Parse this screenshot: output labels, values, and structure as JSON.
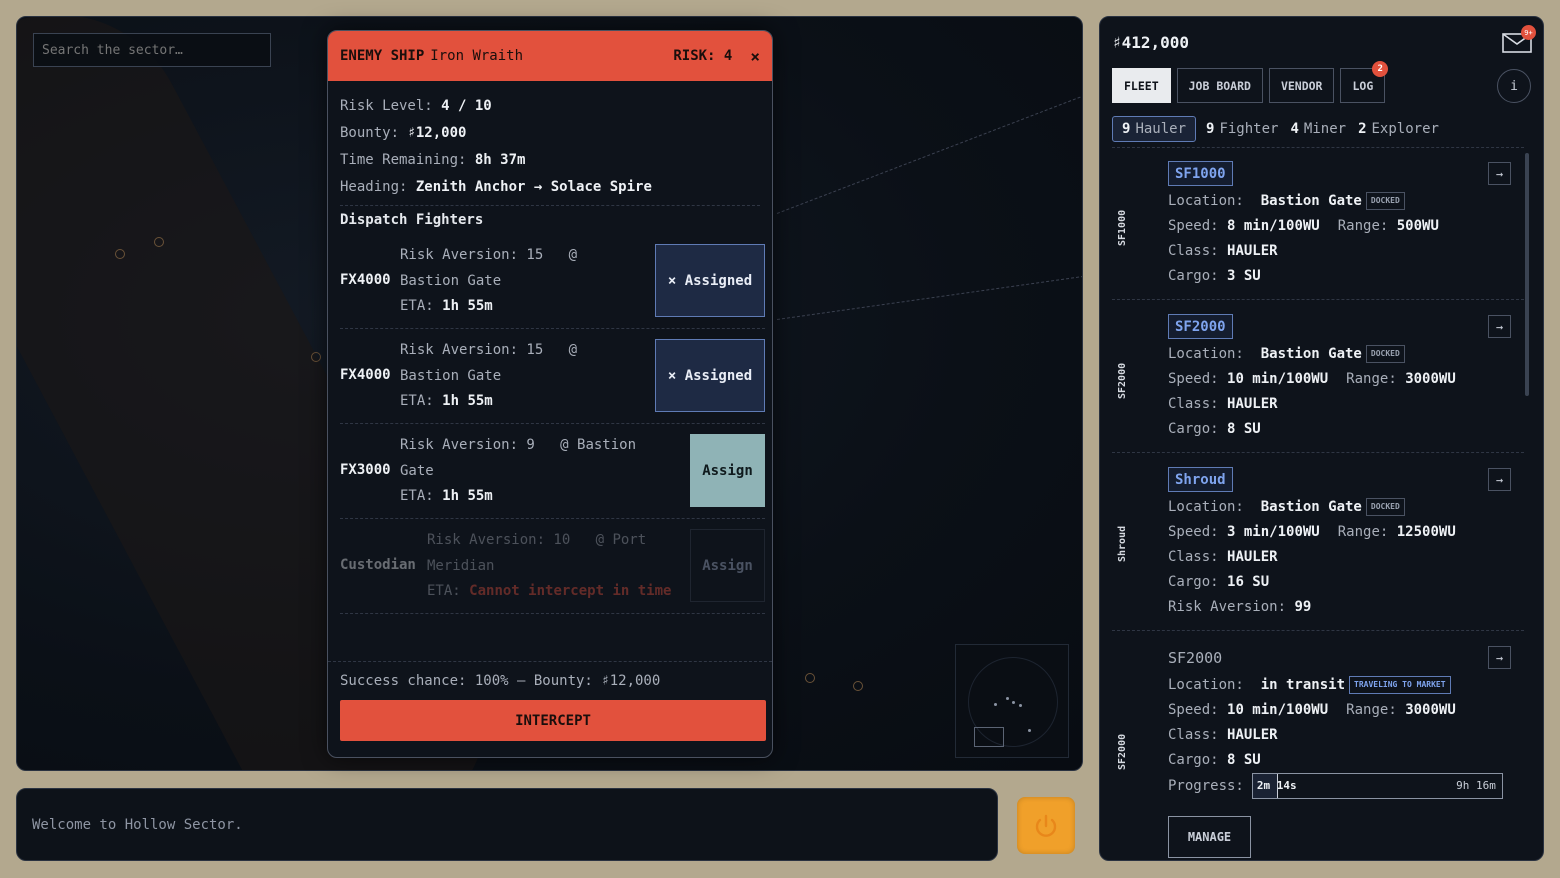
{
  "map": {
    "search_placeholder": "Search the sector…"
  },
  "enemy": {
    "label": "ENEMY SHIP",
    "name": "Iron Wraith",
    "risk_badge": "RISK: 4",
    "close_icon": "×",
    "risk_level_label": "Risk Level:",
    "risk_level_value": "4 / 10",
    "bounty_label": "Bounty:",
    "bounty_value": "♯12,000",
    "time_label": "Time Remaining:",
    "time_value": "8h 37m",
    "heading_label": "Heading:",
    "heading_value": "Zenith Anchor → Solace Spire",
    "dispatch_title": "Dispatch Fighters",
    "fighters": [
      {
        "code": "FX4000",
        "risk_aversion": "Risk Aversion: 15",
        "at": "@",
        "location": "Bastion Gate",
        "eta_label": "ETA:",
        "eta_value": "1h 55m",
        "button": "× Assigned"
      },
      {
        "code": "FX4000",
        "risk_aversion": "Risk Aversion: 15",
        "at": "@",
        "location": "Bastion Gate",
        "eta_label": "ETA:",
        "eta_value": "1h 55m",
        "button": "× Assigned"
      },
      {
        "code": "FX3000",
        "risk_aversion": "Risk Aversion: 9",
        "at": "@ Bastion",
        "location": "Gate",
        "eta_label": "ETA:",
        "eta_value": "1h 55m",
        "button": "Assign"
      },
      {
        "code": "Custodian",
        "risk_aversion": "Risk Aversion: 10",
        "at": "@ Port",
        "location": "Meridian",
        "eta_label": "ETA:",
        "eta_value": "Cannot intercept in time",
        "button": "Assign"
      }
    ],
    "success_text": "Success chance: 100% — Bounty: ♯12,000",
    "intercept_label": "INTERCEPT"
  },
  "console": {
    "message": "Welcome to Hollow Sector."
  },
  "fleet": {
    "credits": "♯412,000",
    "mail_badge": "9+",
    "tabs": [
      {
        "label": "FLEET",
        "active": true
      },
      {
        "label": "JOB BOARD",
        "active": false
      },
      {
        "label": "VENDOR",
        "active": false
      },
      {
        "label": "LOG",
        "active": false,
        "badge": "2"
      }
    ],
    "info_icon": "i",
    "filters": [
      {
        "count": "9",
        "label": "Hauler",
        "active": true
      },
      {
        "count": "9",
        "label": "Fighter",
        "active": false
      },
      {
        "count": "4",
        "label": "Miner",
        "active": false
      },
      {
        "count": "2",
        "label": "Explorer",
        "active": false
      }
    ],
    "ships": [
      {
        "vertical_label": "SF1000",
        "name": "SF1000",
        "location_label": "Location:",
        "location": "Bastion Gate",
        "status": "DOCKED",
        "speed_label": "Speed:",
        "speed": "8 min/100WU",
        "range_label": "Range:",
        "range": "500WU",
        "class_label": "Class:",
        "class": "HAULER",
        "cargo_label": "Cargo:",
        "cargo": "3 SU",
        "goto_icon": "→"
      },
      {
        "vertical_label": "SF2000",
        "name": "SF2000",
        "location_label": "Location:",
        "location": "Bastion Gate",
        "status": "DOCKED",
        "speed_label": "Speed:",
        "speed": "10 min/100WU",
        "range_label": "Range:",
        "range": "3000WU",
        "class_label": "Class:",
        "class": "HAULER",
        "cargo_label": "Cargo:",
        "cargo": "8 SU",
        "goto_icon": "→"
      },
      {
        "vertical_label": "Shroud",
        "name": "Shroud",
        "location_label": "Location:",
        "location": "Bastion Gate",
        "status": "DOCKED",
        "speed_label": "Speed:",
        "speed": "3 min/100WU",
        "range_label": "Range:",
        "range": "12500WU",
        "class_label": "Class:",
        "class": "HAULER",
        "cargo_label": "Cargo:",
        "cargo": "16 SU",
        "risk_label": "Risk Aversion:",
        "risk": "99",
        "goto_icon": "→"
      },
      {
        "vertical_label": "SF2000",
        "name": "SF2000",
        "location_label": "Location:",
        "location": "in transit",
        "status": "TRAVELING TO MARKET",
        "speed_label": "Speed:",
        "speed": "10 min/100WU",
        "range_label": "Range:",
        "range": "3000WU",
        "class_label": "Class:",
        "class": "HAULER",
        "cargo_label": "Cargo:",
        "cargo": "8 SU",
        "progress_label": "Progress:",
        "progress_elapsed": "2m 14s",
        "progress_total": "9h 16m",
        "progress_fraction": 0.1,
        "manage_label": "MANAGE",
        "goto_icon": "→"
      }
    ]
  },
  "colors": {
    "accent_red": "#e2513d",
    "accent_blue": "#7fa4ee",
    "power_orange": "#f0a02a",
    "assign_teal": "#8fb3b6"
  },
  "icons": [
    "search-icon",
    "close-icon",
    "mail-icon",
    "info-icon",
    "arrow-right-icon",
    "power-icon"
  ]
}
